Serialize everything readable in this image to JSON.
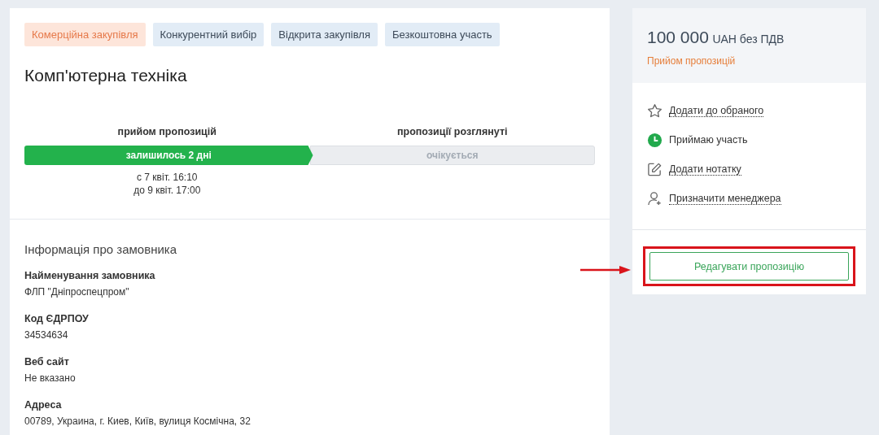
{
  "tags": [
    {
      "label": "Комерційна закупівля",
      "kind": "commercial"
    },
    {
      "label": "Конкурентний вибір",
      "kind": "info"
    },
    {
      "label": "Відкрита закупівля",
      "kind": "info"
    },
    {
      "label": "Безкоштовна участь",
      "kind": "info"
    }
  ],
  "title": "Комп'ютерна техніка",
  "stages": [
    {
      "name": "прийом пропозицій",
      "status": "залишилось 2 дні",
      "active": true,
      "dates": [
        "с 7 квіт. 16:10",
        "до 9 квіт. 17:00"
      ]
    },
    {
      "name": "пропозиції розглянуті",
      "status": "очікується",
      "active": false
    }
  ],
  "customer": {
    "heading": "Інформація про замовника",
    "fields": [
      {
        "label": "Найменування замовника",
        "value": "ФЛП \"Дніпроспецпром\""
      },
      {
        "label": "Код ЄДРПОУ",
        "value": "34534634"
      },
      {
        "label": "Веб сайт",
        "value": "Не вказано"
      },
      {
        "label": "Адреса",
        "value": "00789, Украина, г. Киев, Київ, вулиця Космічна, 32"
      }
    ]
  },
  "price": {
    "amount": "100 000",
    "currency": "UAH без ПДВ",
    "status": "Прийом пропозицій"
  },
  "actions": [
    {
      "label": "Додати до обраного",
      "kind": "star",
      "link": true
    },
    {
      "label": "Приймаю участь",
      "kind": "clock",
      "link": false
    },
    {
      "label": "Додати нотатку",
      "kind": "note",
      "link": true
    },
    {
      "label": "Призначити менеджера",
      "kind": "person",
      "link": true
    }
  ],
  "edit_button": {
    "label": "Редагувати пропозицію",
    "highlighted": true
  }
}
